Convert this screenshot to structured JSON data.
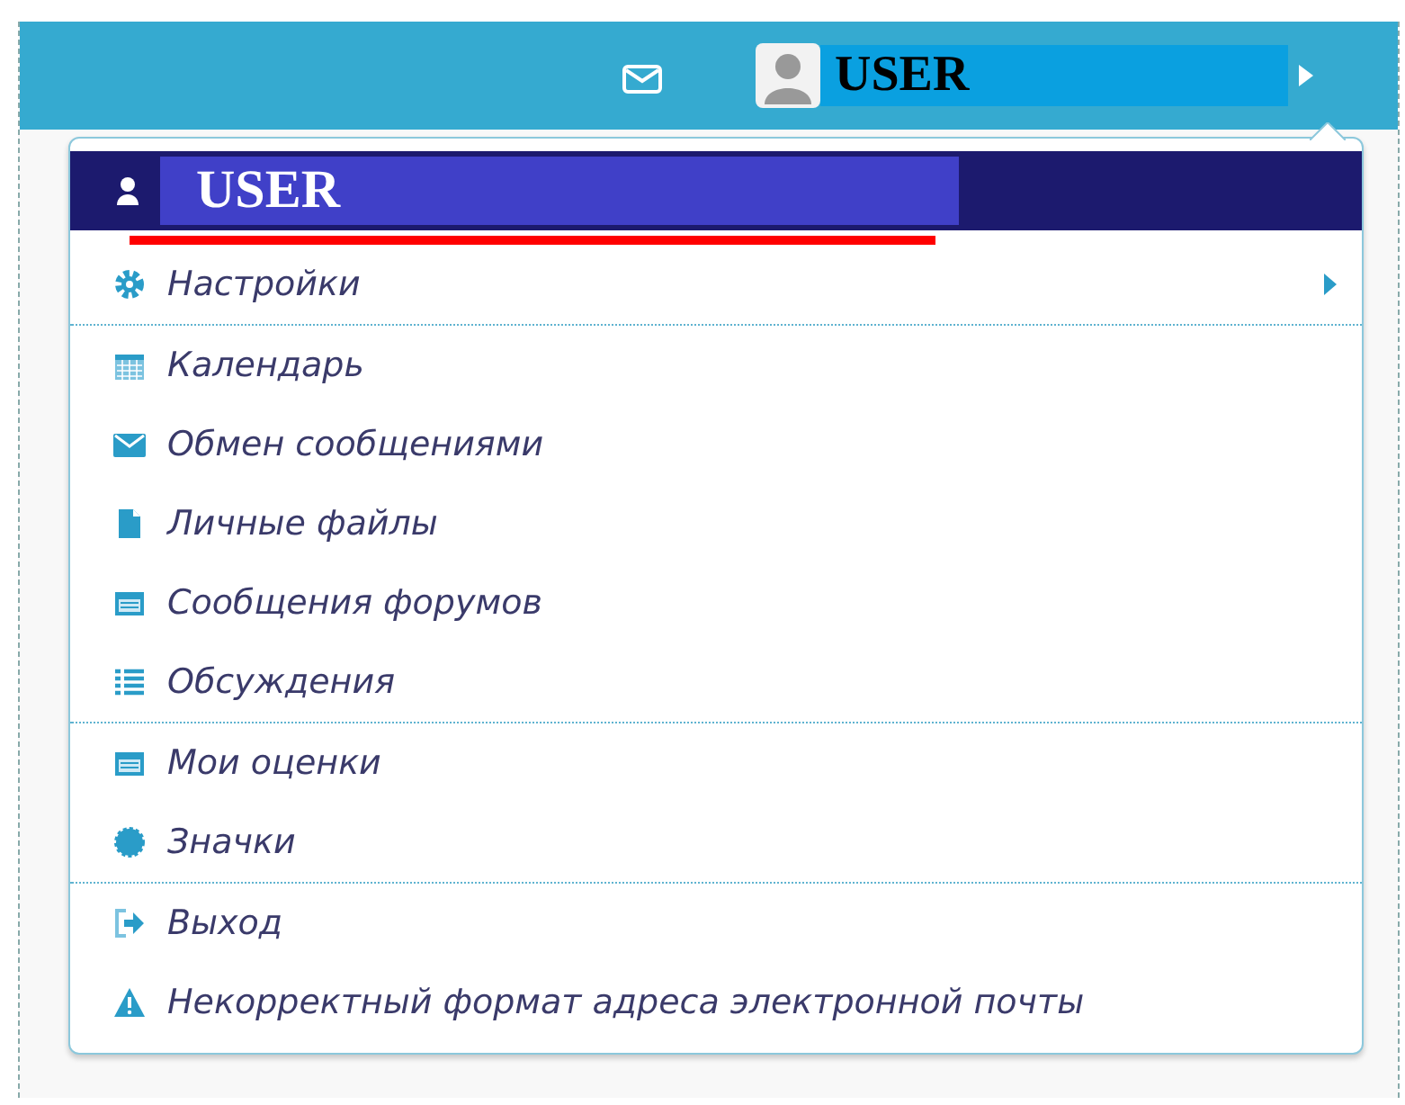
{
  "topbar": {
    "user": "USER"
  },
  "menu": {
    "header": "USER",
    "groups": [
      [
        {
          "label": "Настройки",
          "submenu": true
        }
      ],
      [
        {
          "label": "Календарь",
          "submenu": false
        },
        {
          "label": "Обмен сообщениями",
          "submenu": false
        },
        {
          "label": "Личные файлы",
          "submenu": false
        },
        {
          "label": "Сообщения форумов",
          "submenu": false
        },
        {
          "label": "Обсуждения",
          "submenu": false
        }
      ],
      [
        {
          "label": "Мои оценки",
          "submenu": false
        },
        {
          "label": "Значки",
          "submenu": false
        }
      ],
      [
        {
          "label": "Выход",
          "submenu": false
        },
        {
          "label": "Некорректный формат адреса электронной почты",
          "submenu": false
        }
      ]
    ]
  }
}
